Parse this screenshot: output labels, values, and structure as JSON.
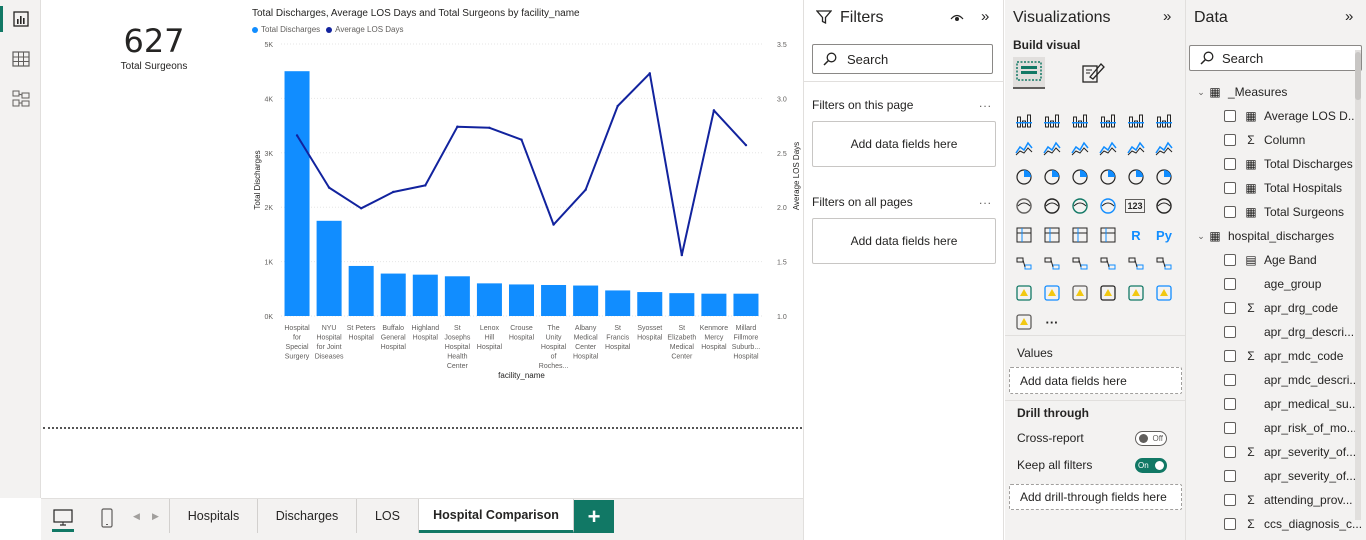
{
  "left_rail": {
    "items": [
      {
        "name": "report-view-icon",
        "active": true
      },
      {
        "name": "table-view-icon",
        "active": false
      },
      {
        "name": "model-view-icon",
        "active": false
      }
    ]
  },
  "card": {
    "value": "627",
    "label": "Total Surgeons"
  },
  "chart_data": {
    "type": "bar",
    "title": "Total Discharges, Average LOS Days and Total Surgeons by facility_name",
    "xlabel": "facility_name",
    "ylabel": "Total Discharges",
    "y2label": "Average LOS Days",
    "legend_position": "top-left",
    "grid": true,
    "categories": [
      [
        "Hospital",
        "for",
        "Special",
        "Surgery"
      ],
      [
        "NYU",
        "Hospital",
        "for Joint",
        "Diseases"
      ],
      [
        "St Peters",
        "Hospital"
      ],
      [
        "Buffalo",
        "General",
        "Hospital"
      ],
      [
        "Highland",
        "Hospital"
      ],
      [
        "St",
        "Josephs",
        "Hospital",
        "Health",
        "Center"
      ],
      [
        "Lenox",
        "Hill",
        "Hospital"
      ],
      [
        "Crouse",
        "Hospital"
      ],
      [
        "The",
        "Unity",
        "Hospital",
        "of",
        "Roches..."
      ],
      [
        "Albany",
        "Medical",
        "Center",
        "Hospital"
      ],
      [
        "St",
        "Francis",
        "Hospital"
      ],
      [
        "Syosset",
        "Hospital"
      ],
      [
        "St",
        "Elizabeth",
        "Medical",
        "Center"
      ],
      [
        "Kenmore",
        "Mercy",
        "Hospital"
      ],
      [
        "Millard",
        "Fillmore",
        "Suburb...",
        "Hospital"
      ]
    ],
    "y_ticks": [
      "0K",
      "1K",
      "2K",
      "3K",
      "4K",
      "5K"
    ],
    "y2_ticks": [
      "1.0",
      "1.5",
      "2.0",
      "2.5",
      "3.0",
      "3.5"
    ],
    "ylim": [
      0,
      5000
    ],
    "y2lim": [
      1.0,
      3.5
    ],
    "series": [
      {
        "name": "Total Discharges",
        "type": "bar",
        "axis": "left",
        "color": "#118dff",
        "values": [
          4500,
          1750,
          920,
          780,
          760,
          730,
          600,
          580,
          570,
          560,
          470,
          440,
          420,
          410,
          410
        ]
      },
      {
        "name": "Average LOS Days",
        "type": "line",
        "axis": "right",
        "color": "#12239e",
        "values": [
          2.66,
          2.18,
          1.99,
          2.14,
          2.2,
          2.74,
          2.73,
          2.62,
          1.84,
          2.16,
          2.93,
          3.23,
          1.56,
          2.89,
          2.57
        ]
      }
    ]
  },
  "page_tabs": {
    "items": [
      "Hospitals",
      "Discharges",
      "LOS",
      "Hospital Comparison"
    ],
    "active": "Hospital Comparison",
    "add": "+"
  },
  "filters": {
    "title": "Filters",
    "search_placeholder": "Search",
    "on_this_page": "Filters on this page",
    "on_all_pages": "Filters on all pages",
    "add_fields": "Add data fields here",
    "more": "..."
  },
  "visualizations": {
    "title": "Visualizations",
    "build_visual": "Build visual",
    "icons": [
      "stacked-bar-icon",
      "stacked-column-icon",
      "clustered-bar-icon",
      "clustered-column-icon",
      "100-bar-icon",
      "100-column-icon",
      "line-chart-icon",
      "area-chart-icon",
      "stacked-area-icon",
      "line-column-icon",
      "line-clustered-column-icon",
      "ribbon-chart-icon",
      "waterfall-icon",
      "funnel-icon",
      "scatter-icon",
      "pie-chart-icon",
      "donut-chart-icon",
      "treemap-icon",
      "map-icon",
      "filled-map-icon",
      "azure-map-icon",
      "gauge-icon",
      "card-icon",
      "multi-row-card-icon",
      "kpi-icon",
      "slicer-icon",
      "table-icon",
      "matrix-icon",
      "r-visual-icon",
      "python-visual-icon",
      "key-influencers-icon",
      "decomposition-tree-icon",
      "qa-icon",
      "narrative-icon",
      "goals-icon",
      "paginated-report-icon",
      "new-card-icon",
      "new-slicer-icon",
      "power-apps-icon",
      "power-automate-icon",
      "power-automate-flow-icon",
      "image-icon",
      "arcgis-icon",
      "more-visuals-icon"
    ],
    "r_label": "R",
    "py_label": "Py",
    "card_label": "123",
    "more_label": "···",
    "values_label": "Values",
    "add_data_fields": "Add data fields here",
    "drill_through": "Drill through",
    "cross_report": "Cross-report",
    "cross_report_state": "Off",
    "keep_all_filters": "Keep all filters",
    "keep_all_filters_state": "On",
    "add_drill_through": "Add drill-through fields here"
  },
  "data_pane": {
    "title": "Data",
    "search_placeholder": "Search",
    "tables": [
      {
        "name": "_Measures",
        "icon": "measure-table-icon",
        "fields": [
          {
            "label": "Average LOS D...",
            "icon": "calculator-icon"
          },
          {
            "label": "Column",
            "icon": "sigma-icon"
          },
          {
            "label": "Total Discharges",
            "icon": "calculator-icon"
          },
          {
            "label": "Total Hospitals",
            "icon": "calculator-icon"
          },
          {
            "label": "Total Surgeons",
            "icon": "calculator-icon"
          }
        ]
      },
      {
        "name": "hospital_discharges",
        "icon": "table-icon",
        "fields": [
          {
            "label": "Age Band",
            "icon": "calculated-column-icon"
          },
          {
            "label": "age_group",
            "icon": ""
          },
          {
            "label": "apr_drg_code",
            "icon": "sigma-icon"
          },
          {
            "label": "apr_drg_descri...",
            "icon": ""
          },
          {
            "label": "apr_mdc_code",
            "icon": "sigma-icon"
          },
          {
            "label": "apr_mdc_descri...",
            "icon": ""
          },
          {
            "label": "apr_medical_su...",
            "icon": ""
          },
          {
            "label": "apr_risk_of_mo...",
            "icon": ""
          },
          {
            "label": "apr_severity_of...",
            "icon": "sigma-icon"
          },
          {
            "label": "apr_severity_of...",
            "icon": ""
          },
          {
            "label": "attending_prov...",
            "icon": "sigma-icon"
          },
          {
            "label": "ccs_diagnosis_c...",
            "icon": "sigma-icon"
          }
        ]
      }
    ]
  }
}
